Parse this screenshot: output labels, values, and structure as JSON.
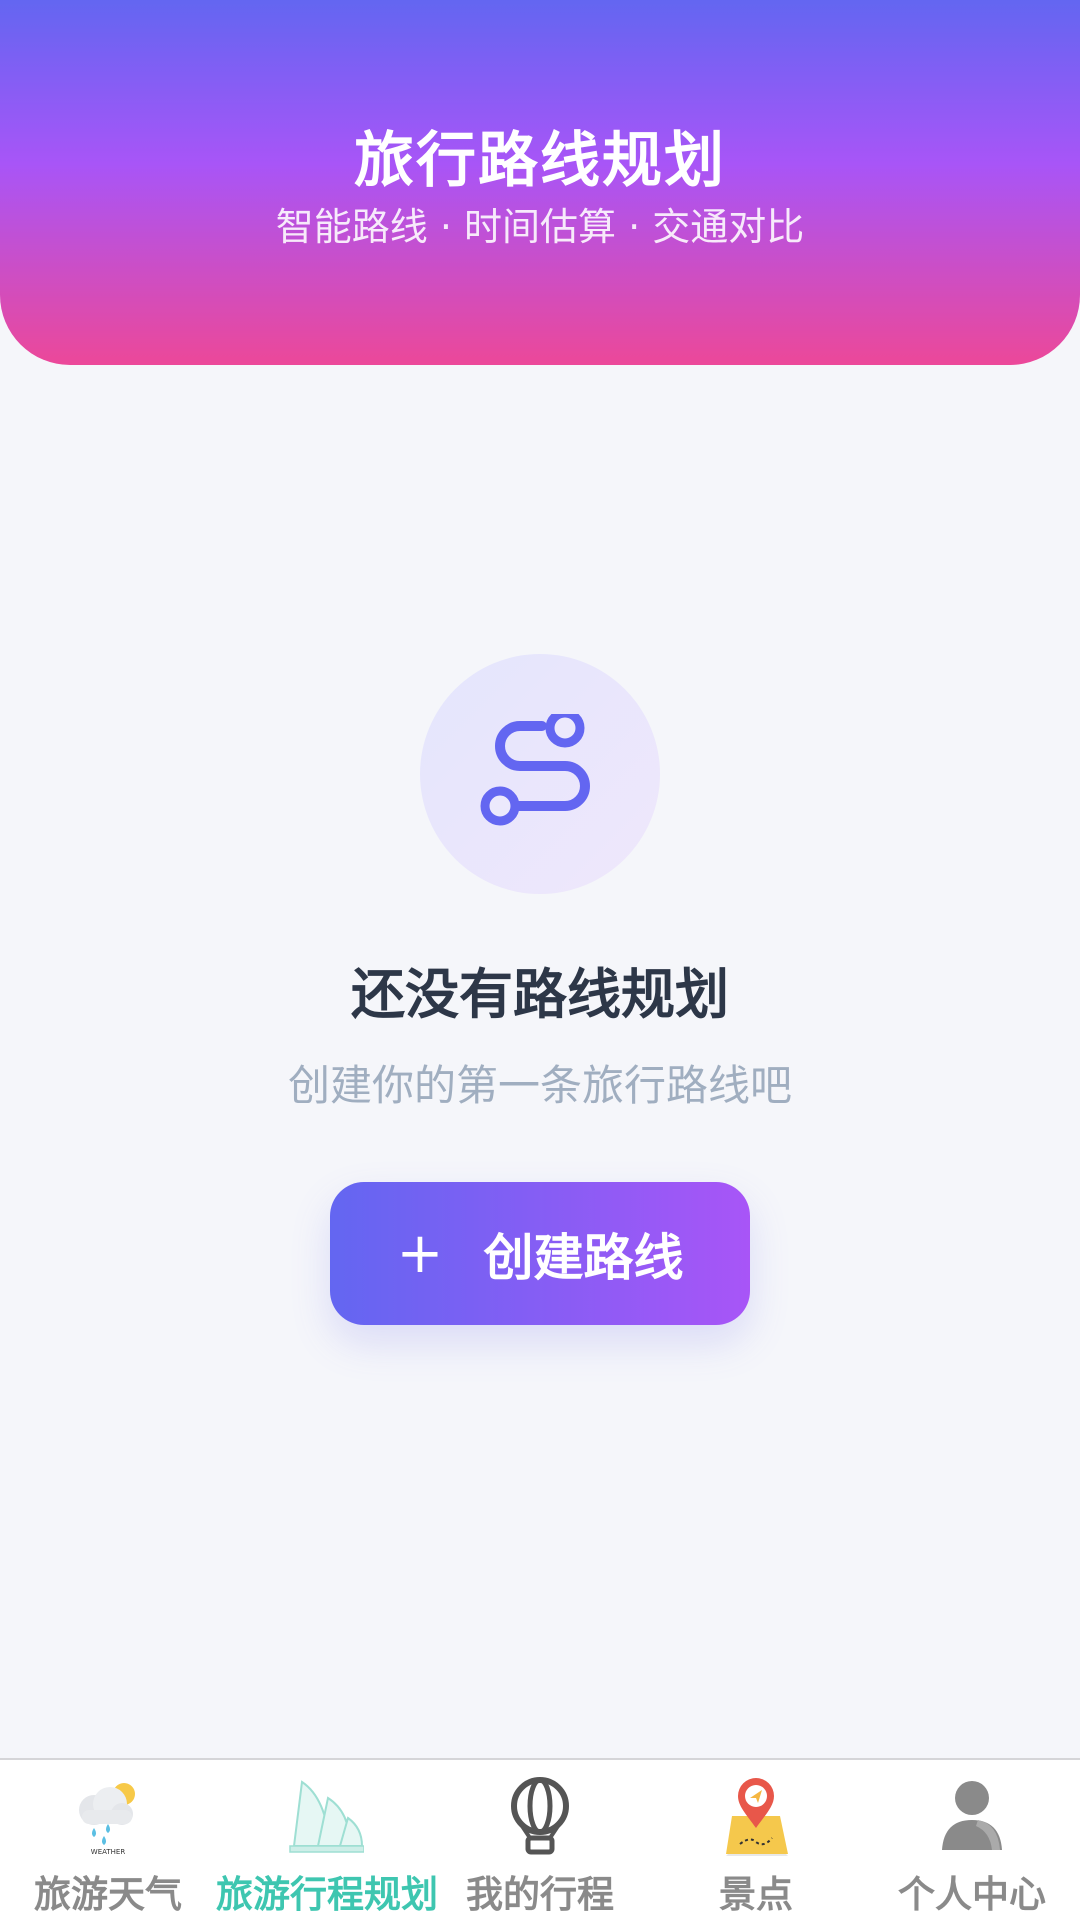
{
  "header": {
    "title": "旅行路线规划",
    "subtitle": "智能路线 · 时间估算 · 交通对比"
  },
  "empty_state": {
    "icon": "route-icon",
    "title": "还没有路线规划",
    "subtitle": "创建你的第一条旅行路线吧",
    "button_icon": "+",
    "button_label": "创建路线"
  },
  "tabbar": {
    "active_index": 1,
    "active_color": "#3ec6b0",
    "items": [
      {
        "label": "旅游天气",
        "icon": "weather-icon",
        "icon_text": "WEATHER"
      },
      {
        "label": "旅游行程规划",
        "icon": "opera-house-icon"
      },
      {
        "label": "我的行程",
        "icon": "hot-air-balloon-icon"
      },
      {
        "label": "景点",
        "icon": "map-pin-icon"
      },
      {
        "label": "个人中心",
        "icon": "user-icon"
      }
    ]
  },
  "colors": {
    "header_gradient": [
      "#6366f1",
      "#a855f7",
      "#ec4899"
    ],
    "button_gradient": [
      "#6366f1",
      "#a855f7"
    ],
    "route_icon": "#6366f1"
  }
}
